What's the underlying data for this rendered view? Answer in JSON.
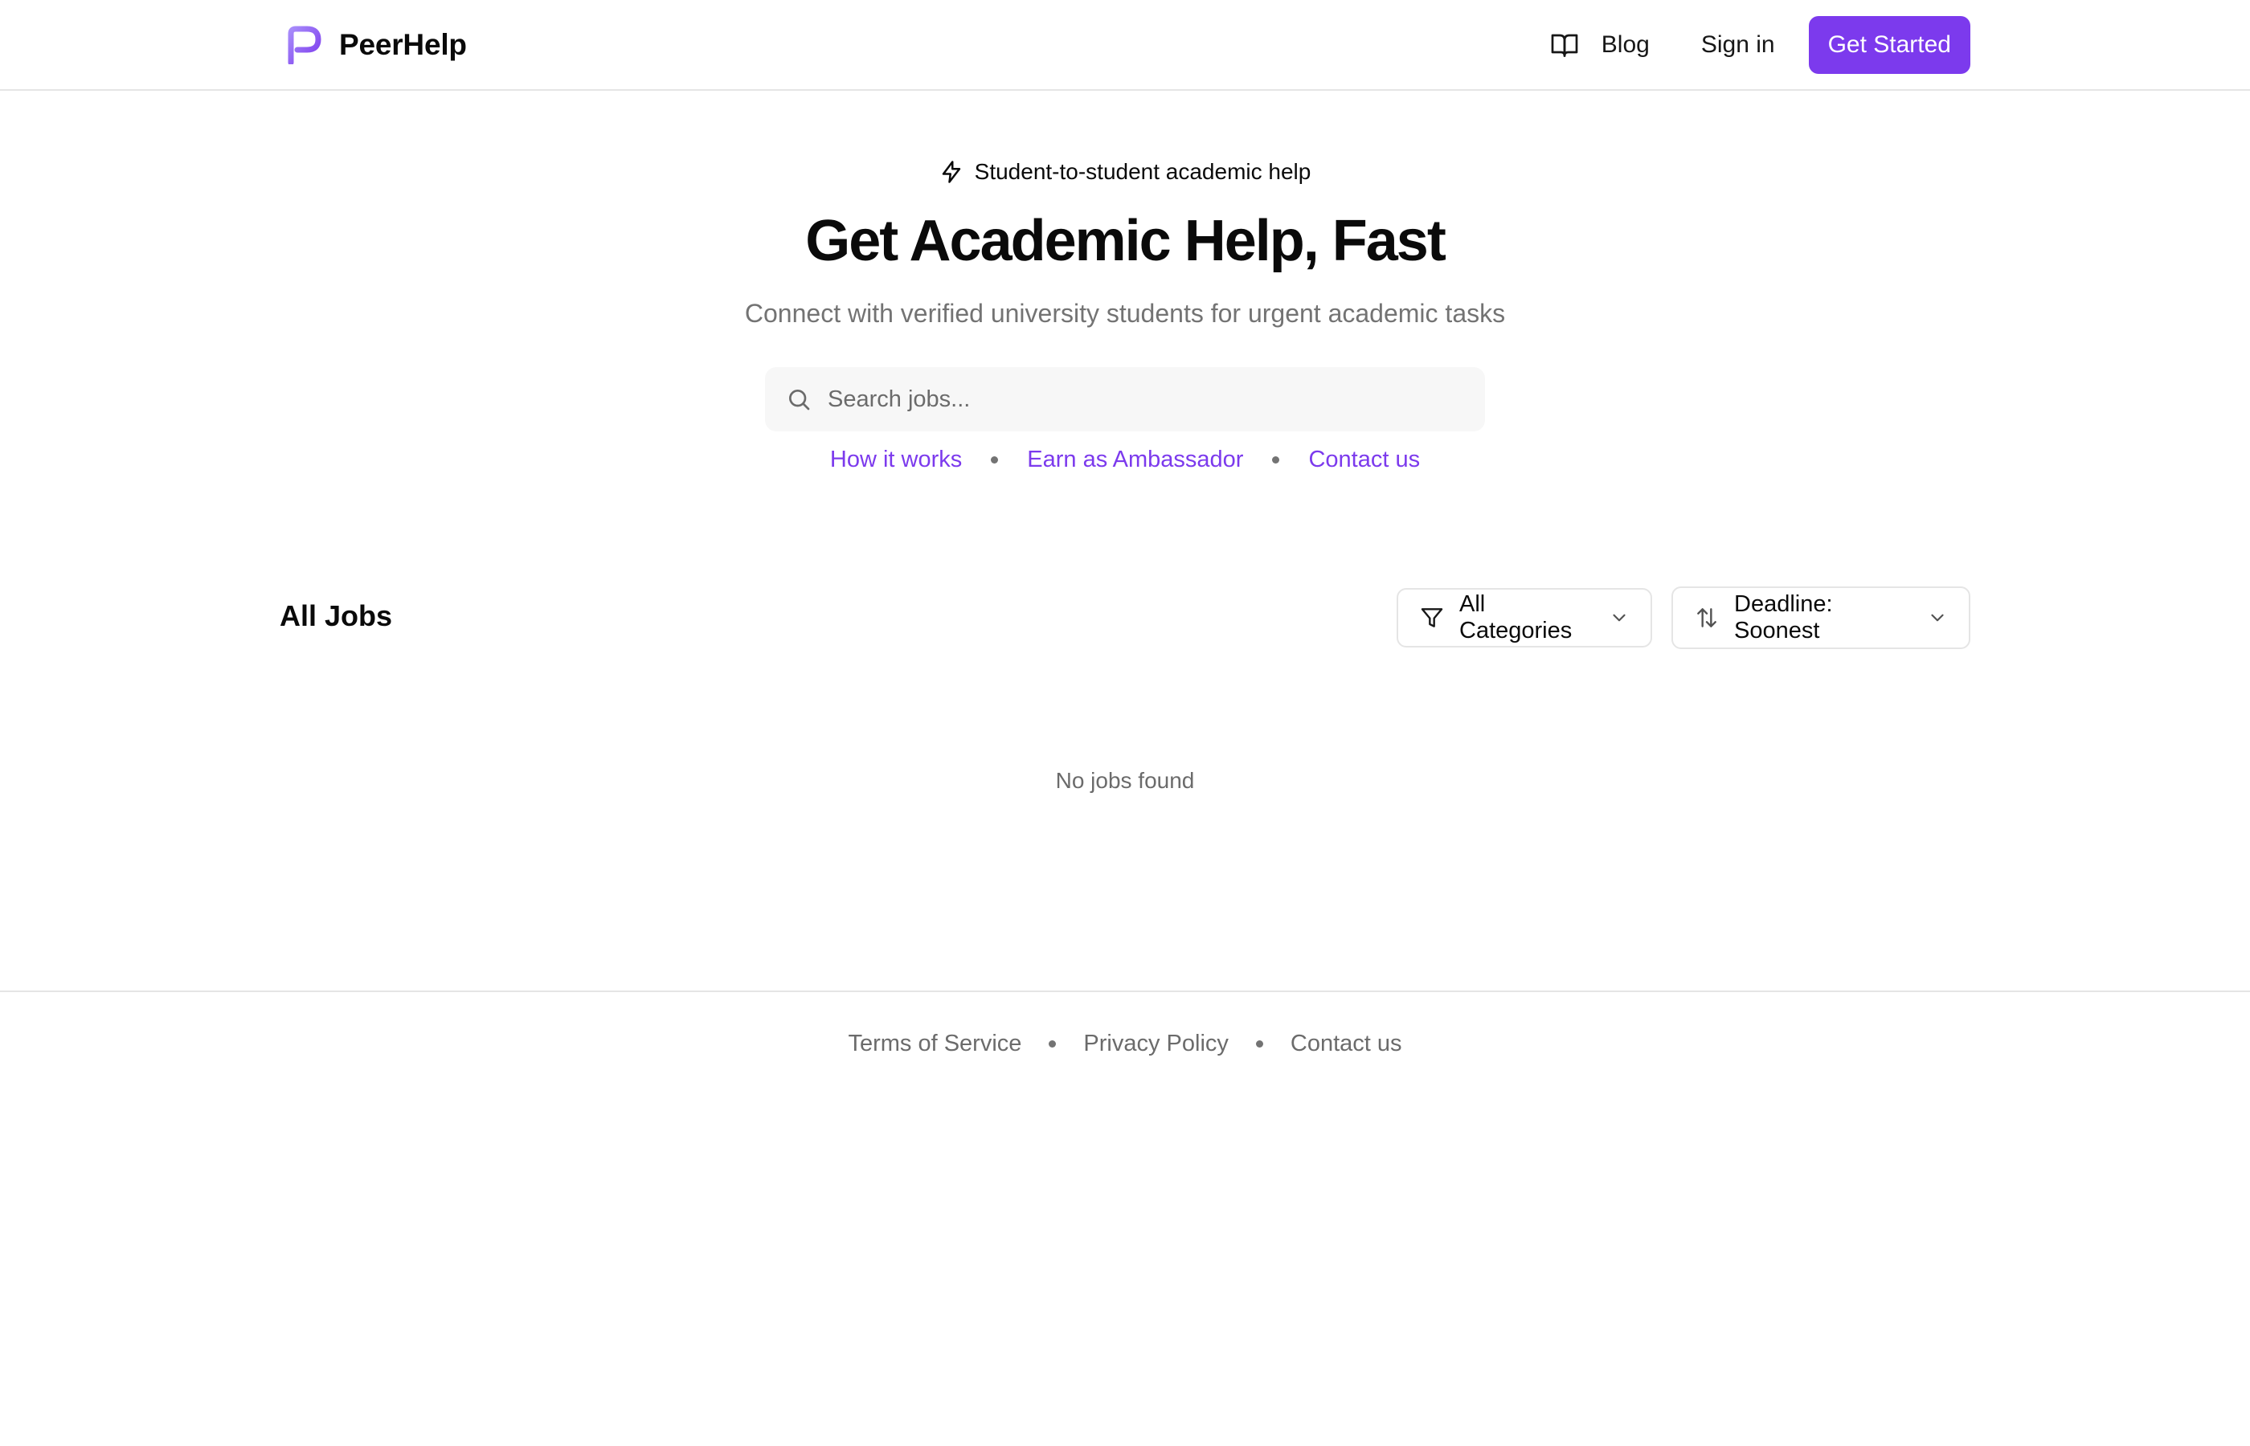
{
  "brand": {
    "name": "PeerHelp",
    "accent": "#7c3aed"
  },
  "nav": {
    "blog_label": "Blog",
    "signin_label": "Sign in",
    "cta_label": "Get Started"
  },
  "hero": {
    "eyebrow": "Student-to-student academic help",
    "title": "Get Academic Help, Fast",
    "subtitle": "Connect with verified university students for urgent academic tasks",
    "search_placeholder": "Search jobs...",
    "links": [
      "How it works",
      "Earn as Ambassador",
      "Contact us"
    ]
  },
  "jobs": {
    "title": "All Jobs",
    "category_filter": "All Categories",
    "sort": "Deadline: Soonest",
    "empty_text": "No jobs found"
  },
  "footer": {
    "links": [
      "Terms of Service",
      "Privacy Policy",
      "Contact us"
    ]
  },
  "icons": {
    "logo": "peerhelp-logo-icon",
    "blog": "book-open-icon",
    "eyebrow": "lightning-icon",
    "search": "search-icon",
    "filter": "filter-icon",
    "sort": "sort-arrows-icon",
    "chevron": "chevron-down-icon"
  }
}
